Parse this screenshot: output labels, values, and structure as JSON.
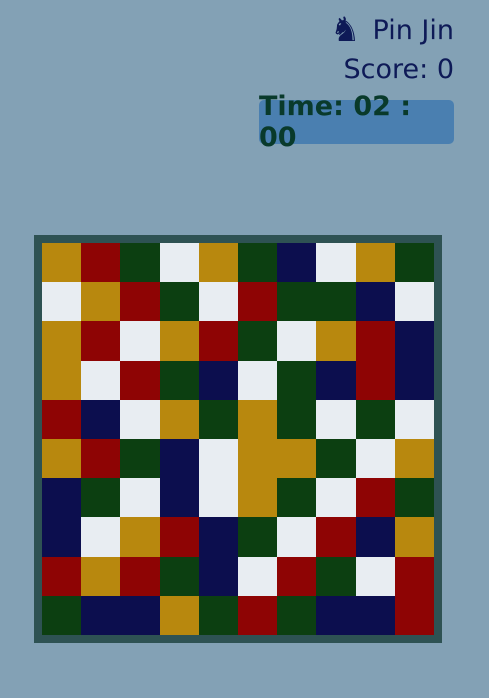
{
  "player": {
    "icon": "knight-chess-icon",
    "name": "Pin Jin"
  },
  "score": {
    "text": "Score: 0",
    "value": 0
  },
  "timer": {
    "text": "Time: 02 : 00"
  },
  "colors": {
    "background": "#83a1b5",
    "board_frame": "#2e5253",
    "Y": "#b8880e",
    "R": "#8e0404",
    "G": "#0c3f11",
    "N": "#0c0e4e",
    "W": "#e8edf2",
    "timer_bg": "#4a7fb0",
    "timer_text": "#093a2b",
    "hud_text": "#0e1a57"
  },
  "board": {
    "rows": [
      [
        "Y",
        "R",
        "G",
        "W",
        "Y",
        "G",
        "N",
        "W",
        "Y",
        "G"
      ],
      [
        "W",
        "Y",
        "R",
        "G",
        "W",
        "R",
        "G",
        "G",
        "N",
        "W"
      ],
      [
        "Y",
        "R",
        "W",
        "Y",
        "R",
        "G",
        "W",
        "Y",
        "R",
        "N"
      ],
      [
        "Y",
        "W",
        "R",
        "G",
        "N",
        "W",
        "G",
        "N",
        "R",
        "N"
      ],
      [
        "R",
        "N",
        "W",
        "Y",
        "G",
        "Y",
        "G",
        "W",
        "G",
        "W"
      ],
      [
        "Y",
        "R",
        "G",
        "N",
        "W",
        "Y",
        "Y",
        "G",
        "W",
        "Y"
      ],
      [
        "N",
        "G",
        "W",
        "N",
        "W",
        "Y",
        "G",
        "W",
        "R",
        "G"
      ],
      [
        "N",
        "W",
        "Y",
        "R",
        "N",
        "G",
        "W",
        "R",
        "N",
        "Y"
      ],
      [
        "R",
        "Y",
        "R",
        "G",
        "N",
        "W",
        "R",
        "G",
        "W",
        "R"
      ],
      [
        "G",
        "N",
        "N",
        "Y",
        "G",
        "R",
        "G",
        "N",
        "N",
        "R"
      ]
    ]
  }
}
